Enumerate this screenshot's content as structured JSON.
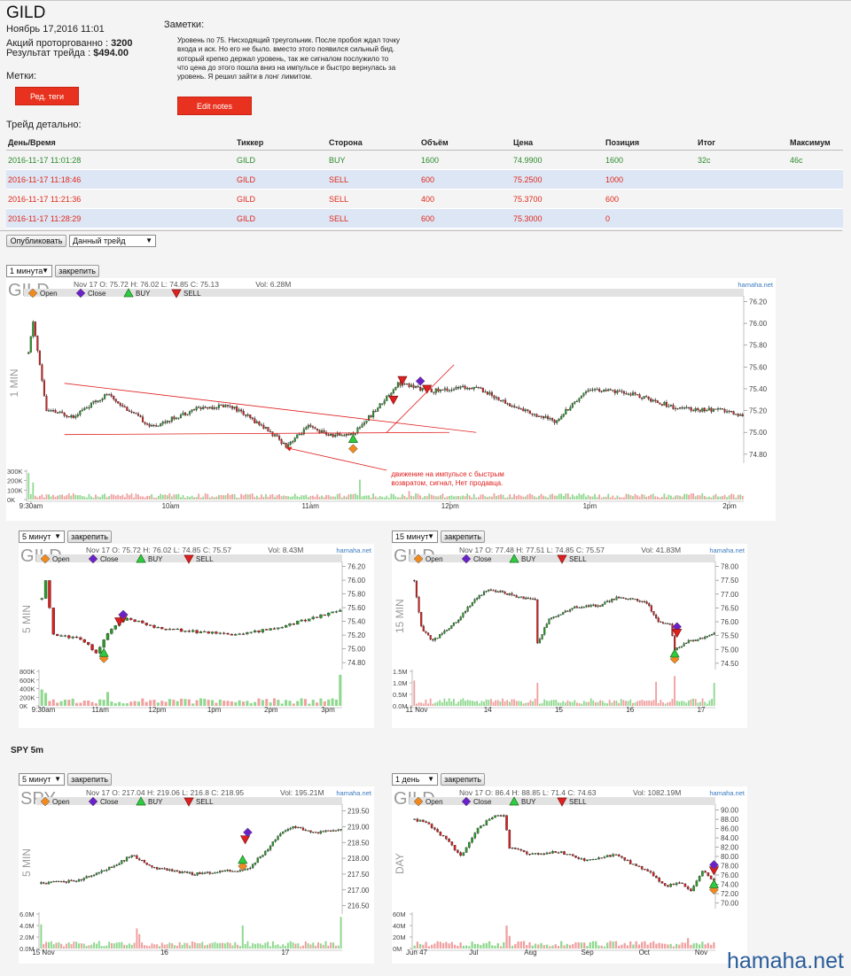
{
  "header": {
    "ticker": "GILD",
    "date": "Ноябрь 17,2016 11:01",
    "shares_label": "Акций проторгованно : ",
    "shares_value": "3200",
    "result_label": "Результат трейда : ",
    "result_value": "$494.00",
    "tags_label": "Метки:",
    "tags_button": "Ред. теги",
    "notes_label": "Заметки:",
    "notes_text": "Уровень по 75. Нисходящий треугольник. После пробоя ждал точку входа и аск. Но его не было. вместо этого появился сильный бид. который крепко держал уровень, так же сигналом послужило то что цена до этого пошла вниз на импульсе и быстро вернулась за уровень. Я решил зайти в лонг лимитом.",
    "notes_button": "Edit notes",
    "detail_label": "Трейд детально:"
  },
  "table": {
    "columns": [
      "День/Время",
      "Тиккер",
      "Сторона",
      "Объём",
      "Цена",
      "Позиция",
      "Итог",
      "Максимум"
    ],
    "rows": [
      {
        "side_class": "buy",
        "cells": [
          "2016-11-17 11:01:28",
          "GILD",
          "BUY",
          "1600",
          "74.9900",
          "1600",
          "32c",
          "46c"
        ]
      },
      {
        "side_class": "sell",
        "cells": [
          "2016-11-17 11:18:46",
          "GILD",
          "SELL",
          "600",
          "75.2500",
          "1000",
          "",
          ""
        ]
      },
      {
        "side_class": "sell",
        "cells": [
          "2016-11-17 11:21:36",
          "GILD",
          "SELL",
          "400",
          "75.3700",
          "600",
          "",
          ""
        ]
      },
      {
        "side_class": "sell",
        "cells": [
          "2016-11-17 11:28:29",
          "GILD",
          "SELL",
          "600",
          "75.3000",
          "0",
          "",
          ""
        ]
      }
    ]
  },
  "controls": {
    "publish_button": "Опубликовать",
    "trade_select": "Данный трейд",
    "pin_button": "закрепить",
    "spy_heading": "SPY 5m"
  },
  "legend": {
    "open": "Open",
    "close": "Close",
    "buy": "BUY",
    "sell": "SELL",
    "brand": "hamaha.net"
  },
  "colors": {
    "up": "#2a9a2a",
    "down": "#d42020",
    "open_marker": "#f08a1e",
    "close_marker": "#6a22c8",
    "buy_marker": "#2ecc40",
    "sell_marker": "#e02020",
    "annotation": "#e02020"
  },
  "watermark": "hamaha.net",
  "chart_data": [
    {
      "id": "gild-1m",
      "type": "candlestick",
      "interval_select": "1 минута",
      "symbol": "GILD",
      "period_label": "1 MIN",
      "ohlc_text": "Nov 17 O: 75.72 H: 76.02 L: 74.85 C: 75.13",
      "vol_text": "Vol: 6.28M",
      "y_ticks": [
        "76.20",
        "76.00",
        "75.80",
        "75.60",
        "75.40",
        "75.20",
        "75.00",
        "74.80"
      ],
      "y_range": [
        74.75,
        76.22
      ],
      "vol_ticks": [
        "300K",
        "200K",
        "100K",
        "0K"
      ],
      "vol_max": 300000,
      "x_ticks": [
        "9:30am",
        "10am",
        "11am",
        "12pm",
        "1pm",
        "2pm"
      ],
      "annotation": "движение на импульсе с быстрым возвратом, сигнал, Нет продавца.",
      "candles": 320,
      "seed": 11,
      "path": [
        [
          0,
          75.72
        ],
        [
          2,
          76.02
        ],
        [
          8,
          75.2
        ],
        [
          20,
          75.15
        ],
        [
          35,
          75.35
        ],
        [
          55,
          75.05
        ],
        [
          75,
          75.22
        ],
        [
          90,
          75.25
        ],
        [
          105,
          75.05
        ],
        [
          115,
          74.88
        ],
        [
          125,
          75.05
        ],
        [
          135,
          74.97
        ],
        [
          145,
          74.99
        ],
        [
          155,
          75.2
        ],
        [
          165,
          75.45
        ],
        [
          180,
          75.38
        ],
        [
          200,
          75.42
        ],
        [
          215,
          75.25
        ],
        [
          235,
          75.1
        ],
        [
          250,
          75.4
        ],
        [
          270,
          75.35
        ],
        [
          290,
          75.22
        ],
        [
          310,
          75.2
        ],
        [
          320,
          75.15
        ]
      ],
      "markers": [
        {
          "kind": "open",
          "i": 145,
          "price": 74.85
        },
        {
          "kind": "buy",
          "i": 145,
          "price": 74.94
        },
        {
          "kind": "sell",
          "i": 163,
          "price": 75.3
        },
        {
          "kind": "sell",
          "i": 167,
          "price": 75.48
        },
        {
          "kind": "close",
          "i": 175,
          "price": 75.47
        },
        {
          "kind": "sell",
          "i": 178,
          "price": 75.4
        }
      ],
      "volume_spikes": [
        [
          0,
          280000
        ],
        [
          2,
          180000
        ],
        [
          148,
          210000
        ],
        [
          170,
          90000
        ]
      ]
    },
    {
      "id": "gild-5m",
      "type": "candlestick",
      "interval_select": "5 минут",
      "symbol": "GILD",
      "period_label": "5 MIN",
      "ohlc_text": "Nov 17 O: 75.72 H: 76.02 L: 74.85 C: 75.57",
      "vol_text": "Vol: 8.43M",
      "y_ticks": [
        "76.20",
        "76.00",
        "75.80",
        "75.60",
        "75.40",
        "75.20",
        "75.00",
        "74.80"
      ],
      "y_range": [
        74.75,
        76.22
      ],
      "vol_ticks": [
        "800K",
        "600K",
        "400K",
        "200K",
        "0K"
      ],
      "vol_max": 800000,
      "x_ticks": [
        "9:30am",
        "11am",
        "12pm",
        "1pm",
        "2pm",
        "3pm"
      ],
      "candles": 78,
      "seed": 5,
      "path": [
        [
          0,
          75.72
        ],
        [
          1,
          76.0
        ],
        [
          3,
          75.2
        ],
        [
          10,
          75.15
        ],
        [
          14,
          74.95
        ],
        [
          18,
          75.3
        ],
        [
          22,
          75.45
        ],
        [
          30,
          75.3
        ],
        [
          40,
          75.25
        ],
        [
          50,
          75.2
        ],
        [
          55,
          75.25
        ],
        [
          60,
          75.3
        ],
        [
          70,
          75.45
        ],
        [
          77,
          75.57
        ]
      ],
      "markers": [
        {
          "kind": "open",
          "i": 16,
          "price": 74.86
        },
        {
          "kind": "buy",
          "i": 16,
          "price": 74.94
        },
        {
          "kind": "sell",
          "i": 20,
          "price": 75.4
        },
        {
          "kind": "sell",
          "i": 21,
          "price": 75.45
        },
        {
          "kind": "close",
          "i": 21,
          "price": 75.5
        }
      ],
      "volume_spikes": [
        [
          0,
          380000
        ],
        [
          1,
          300000
        ],
        [
          17,
          320000
        ],
        [
          77,
          720000
        ]
      ]
    },
    {
      "id": "gild-15m",
      "type": "candlestick",
      "interval_select": "15 минут",
      "symbol": "GILD",
      "period_label": "15 MIN",
      "ohlc_text": "Nov 17 O: 77.48 H: 77.51 L: 74.85 C: 75.57",
      "vol_text": "Vol: 41.83M",
      "y_ticks": [
        "78.00",
        "77.50",
        "77.00",
        "76.50",
        "76.00",
        "75.50",
        "75.00",
        "74.50"
      ],
      "y_range": [
        74.4,
        78.05
      ],
      "vol_ticks": [
        "1.5M",
        "1.0M",
        "0.5M",
        "0.0M"
      ],
      "vol_max": 1500000,
      "x_ticks": [
        "11 Nov",
        "14",
        "15",
        "16",
        "17"
      ],
      "candles": 130,
      "seed": 15,
      "path": [
        [
          0,
          77.5
        ],
        [
          3,
          75.8
        ],
        [
          8,
          75.3
        ],
        [
          18,
          76.0
        ],
        [
          26,
          76.8
        ],
        [
          32,
          77.2
        ],
        [
          45,
          76.9
        ],
        [
          52,
          76.8
        ],
        [
          53,
          75.2
        ],
        [
          58,
          76.1
        ],
        [
          68,
          76.5
        ],
        [
          80,
          76.6
        ],
        [
          88,
          76.9
        ],
        [
          100,
          76.7
        ],
        [
          105,
          76.0
        ],
        [
          110,
          75.9
        ],
        [
          112,
          75.0
        ],
        [
          118,
          75.3
        ],
        [
          124,
          75.4
        ],
        [
          129,
          75.57
        ]
      ],
      "markers": [
        {
          "kind": "open",
          "i": 112,
          "price": 74.65
        },
        {
          "kind": "buy",
          "i": 112,
          "price": 74.85
        },
        {
          "kind": "close",
          "i": 113,
          "price": 75.82
        },
        {
          "kind": "sell",
          "i": 113,
          "price": 75.6
        }
      ],
      "volume_spikes": [
        [
          0,
          1100000
        ],
        [
          53,
          1000000
        ],
        [
          104,
          1050000
        ],
        [
          112,
          1300000
        ],
        [
          129,
          1000000
        ]
      ]
    },
    {
      "id": "spy-5m",
      "type": "candlestick",
      "interval_select": "5 минут",
      "symbol": "SPY",
      "period_label": "5 MIN",
      "ohlc_text": "Nov 17 O: 217.04 H: 219.06 L: 216.8 C: 218.95",
      "vol_text": "Vol: 195.21M",
      "y_ticks": [
        "219.50",
        "219.00",
        "218.50",
        "218.00",
        "217.50",
        "217.00",
        "216.50"
      ],
      "y_range": [
        216.35,
        219.6
      ],
      "vol_ticks": [
        "6.0M",
        "4.0M",
        "2.0M",
        "0.0M"
      ],
      "vol_max": 6000000,
      "x_ticks": [
        "15 Nov",
        "16",
        "17"
      ],
      "candles": 120,
      "seed": 23,
      "path": [
        [
          0,
          217.2
        ],
        [
          15,
          217.3
        ],
        [
          30,
          217.8
        ],
        [
          36,
          218.1
        ],
        [
          45,
          217.7
        ],
        [
          60,
          217.5
        ],
        [
          75,
          217.6
        ],
        [
          82,
          217.65
        ],
        [
          90,
          218.3
        ],
        [
          95,
          218.8
        ],
        [
          100,
          219.0
        ],
        [
          110,
          218.8
        ],
        [
          119,
          218.95
        ]
      ],
      "markers": [
        {
          "kind": "open",
          "i": 80,
          "price": 217.75
        },
        {
          "kind": "buy",
          "i": 80,
          "price": 217.95
        },
        {
          "kind": "sell",
          "i": 81,
          "price": 218.6
        },
        {
          "kind": "close",
          "i": 82,
          "price": 218.82
        }
      ],
      "volume_spikes": [
        [
          0,
          4200000
        ],
        [
          38,
          3500000
        ],
        [
          39,
          2500000
        ],
        [
          80,
          4000000
        ],
        [
          119,
          5500000
        ]
      ]
    },
    {
      "id": "gild-day",
      "type": "candlestick",
      "interval_select": "1 день",
      "symbol": "GILD",
      "period_label": "DAY",
      "ohlc_text": "Nov 17 O: 86.4 H: 88.85 L: 71.4 C: 74.63",
      "vol_text": "Vol: 1082.19M",
      "y_ticks": [
        "90.00",
        "88.00",
        "86.00",
        "84.00",
        "82.00",
        "80.00",
        "78.00",
        "76.00",
        "74.00",
        "72.00",
        "70.00"
      ],
      "y_range": [
        69.5,
        90.5
      ],
      "vol_ticks": [
        "60M",
        "40M",
        "20M",
        "0M"
      ],
      "vol_max": 60000000,
      "x_ticks": [
        "Jun 47",
        "Jul",
        "Aug",
        "Sep",
        "Oct",
        "Nov"
      ],
      "candles": 105,
      "seed": 31,
      "path": [
        [
          0,
          88.0
        ],
        [
          5,
          87.0
        ],
        [
          12,
          83.0
        ],
        [
          16,
          80.0
        ],
        [
          22,
          86.0
        ],
        [
          27,
          88.5
        ],
        [
          31,
          89.0
        ],
        [
          33,
          82.0
        ],
        [
          40,
          80.5
        ],
        [
          50,
          81.0
        ],
        [
          60,
          79.0
        ],
        [
          70,
          80.5
        ],
        [
          75,
          78.5
        ],
        [
          82,
          76.5
        ],
        [
          87,
          73.5
        ],
        [
          92,
          74.5
        ],
        [
          96,
          72.5
        ],
        [
          100,
          77.0
        ],
        [
          104,
          74.63
        ]
      ],
      "markers": [
        {
          "kind": "open",
          "i": 104,
          "price": 72.8
        },
        {
          "kind": "buy",
          "i": 104,
          "price": 74.0
        },
        {
          "kind": "sell",
          "i": 104,
          "price": 77.0
        },
        {
          "kind": "close",
          "i": 104,
          "price": 78.2
        }
      ],
      "volume_spikes": [
        [
          32,
          40000000
        ],
        [
          33,
          22000000
        ],
        [
          95,
          18000000
        ],
        [
          100,
          12000000
        ]
      ]
    }
  ]
}
